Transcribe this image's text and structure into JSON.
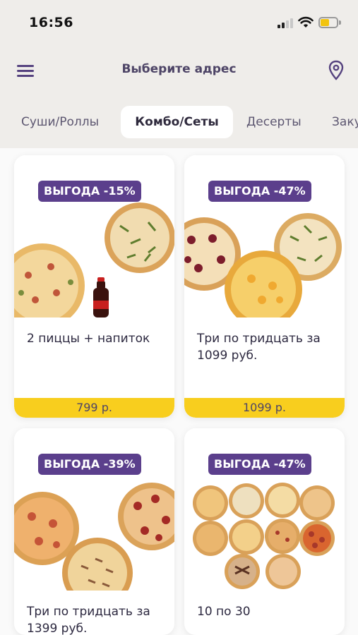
{
  "status_bar": {
    "time": "16:56"
  },
  "header": {
    "address_prompt": "Выберите адрес"
  },
  "tabs": [
    {
      "label": "Суши/Роллы"
    },
    {
      "label": "Комбо/Сеты",
      "active": true
    },
    {
      "label": "Десерты"
    },
    {
      "label": "Закуски"
    }
  ],
  "products": [
    {
      "badge": "ВЫГОДА -15%",
      "title": "2 пиццы + напиток",
      "price": "799 р."
    },
    {
      "badge": "ВЫГОДА -47%",
      "title": "Три по тридцать за 1099 руб.",
      "price": "1099 р."
    },
    {
      "badge": "ВЫГОДА -39%",
      "title": "Три по тридцать за 1399 руб.",
      "price": ""
    },
    {
      "badge": "ВЫГОДА -47%",
      "title": "10 по 30",
      "price": ""
    }
  ],
  "colors": {
    "accent": "#5b3f8c",
    "price_bar": "#f8ce1e",
    "background": "#efedea"
  }
}
